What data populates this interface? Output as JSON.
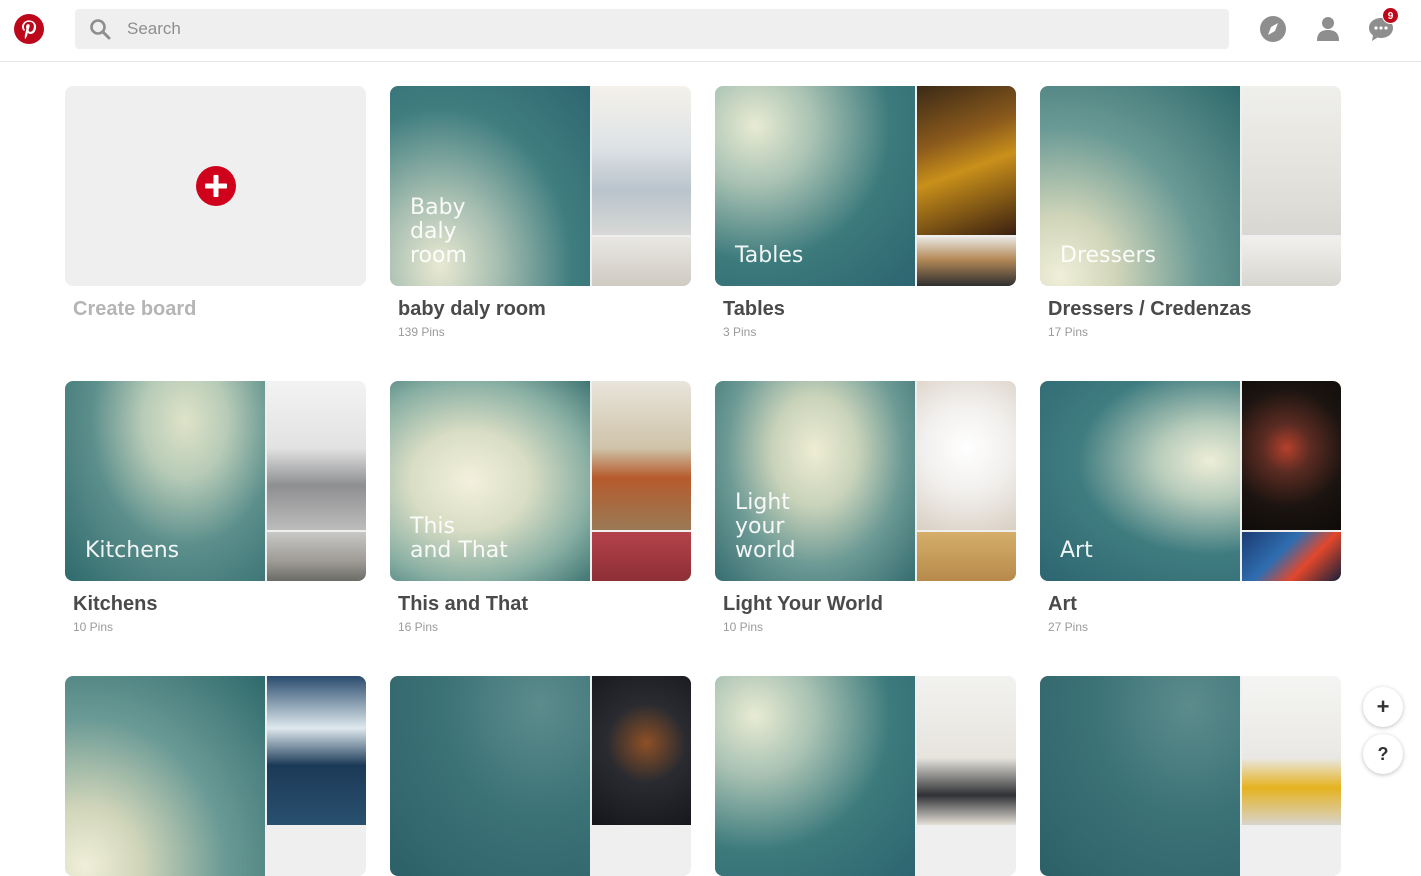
{
  "header": {
    "search_placeholder": "Search",
    "notifications_count": "9",
    "icons": {
      "logo": "pinterest-logo",
      "search": "search-icon",
      "explore": "compass-icon",
      "profile": "user-icon",
      "messages": "chat-bubble-icon"
    },
    "brand_color": "#bd081c"
  },
  "create_board": {
    "label": "Create board",
    "icon": "plus-circle-icon"
  },
  "boards": [
    {
      "title": "baby daly room",
      "count": "139 Pins",
      "cover_label": "Baby\ndaly\nroom"
    },
    {
      "title": "Tables",
      "count": "3 Pins",
      "cover_label": "Tables"
    },
    {
      "title": "Dressers / Credenzas",
      "count": "17 Pins",
      "cover_label": "Dressers"
    },
    {
      "title": "Kitchens",
      "count": "10 Pins",
      "cover_label": "Kitchens"
    },
    {
      "title": "This and That",
      "count": "16 Pins",
      "cover_label": "This\nand That"
    },
    {
      "title": "Light Your World",
      "count": "10 Pins",
      "cover_label": "Light\nyour\nworld"
    },
    {
      "title": "Art",
      "count": "27 Pins",
      "cover_label": "Art"
    }
  ],
  "floating": {
    "add_label": "+",
    "help_label": "?"
  }
}
